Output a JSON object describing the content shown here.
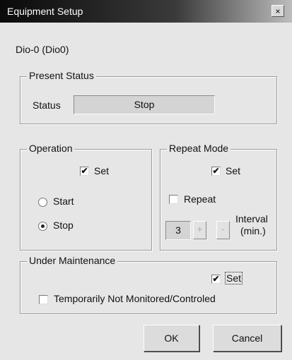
{
  "window": {
    "title": "Equipment Setup",
    "close": "×"
  },
  "device": "Dio-0  (Dio0)",
  "present_status": {
    "legend": "Present Status",
    "status_label": "Status",
    "status_value": "Stop"
  },
  "operation": {
    "legend": "Operation",
    "set_label": "Set",
    "set_checked": true,
    "start_label": "Start",
    "stop_label": "Stop",
    "selected": "Stop"
  },
  "repeat_mode": {
    "legend": "Repeat Mode",
    "set_label": "Set",
    "set_checked": true,
    "repeat_label": "Repeat",
    "repeat_checked": false,
    "interval_value": "3",
    "plus": "+",
    "minus": "-",
    "interval_label_1": "Interval",
    "interval_label_2": "(min.)"
  },
  "maintenance": {
    "legend": "Under Maintenance",
    "set_label": "Set",
    "set_checked": true,
    "temp_label": "Temporarily Not Monitored/Controled",
    "temp_checked": false
  },
  "buttons": {
    "ok": "OK",
    "cancel": "Cancel"
  },
  "check_mark": "✔"
}
